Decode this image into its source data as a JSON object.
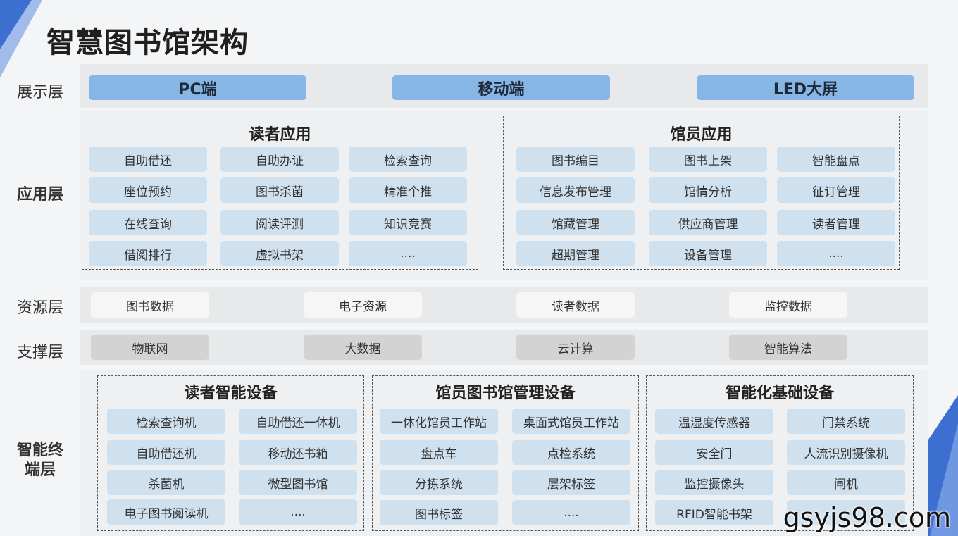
{
  "title": "智慧图书馆架构",
  "layers": {
    "display": "展示层",
    "application": "应用层",
    "resource": "资源层",
    "support": "支撑层",
    "terminal_line1": "智能终",
    "terminal_line2": "端层"
  },
  "display_items": [
    "PC端",
    "移动端",
    "LED大屏"
  ],
  "reader_app": {
    "title": "读者应用",
    "items": [
      "自助借还",
      "自助办证",
      "检索查询",
      "座位预约",
      "图书杀菌",
      "精准个推",
      "在线查询",
      "阅读评测",
      "知识竞赛",
      "借阅排行",
      "虚拟书架",
      "...."
    ]
  },
  "staff_app": {
    "title": "馆员应用",
    "items": [
      "图书编目",
      "图书上架",
      "智能盘点",
      "信息发布管理",
      "馆情分析",
      "征订管理",
      "馆藏管理",
      "供应商管理",
      "读者管理",
      "超期管理",
      "设备管理",
      "...."
    ]
  },
  "resource_items": [
    "图书数据",
    "电子资源",
    "读者数据",
    "监控数据"
  ],
  "support_items": [
    "物联网",
    "大数据",
    "云计算",
    "智能算法"
  ],
  "reader_devices": {
    "title": "读者智能设备",
    "items": [
      "检索查询机",
      "自助借还一体机",
      "自助借还机",
      "移动还书箱",
      "杀菌机",
      "微型图书馆",
      "电子图书阅读机",
      "...."
    ]
  },
  "staff_devices": {
    "title": "馆员图书馆管理设备",
    "items": [
      "一体化馆员工作站",
      "桌面式馆员工作站",
      "盘点车",
      "点检系统",
      "分拣系统",
      "层架标签",
      "图书标签",
      "...."
    ]
  },
  "base_devices": {
    "title": "智能化基础设备",
    "items": [
      "温湿度传感器",
      "门禁系统",
      "安全门",
      "人流识别摄像机",
      "监控摄像头",
      "闸机",
      "RFID智能书架",
      ""
    ]
  },
  "watermark": "gsyjs98.com",
  "colors": {
    "display_pill": "#85b6e4",
    "app_pill": "#cfe0ee",
    "support_pill": "#d3d3d3",
    "band": "#e8e9eb"
  }
}
